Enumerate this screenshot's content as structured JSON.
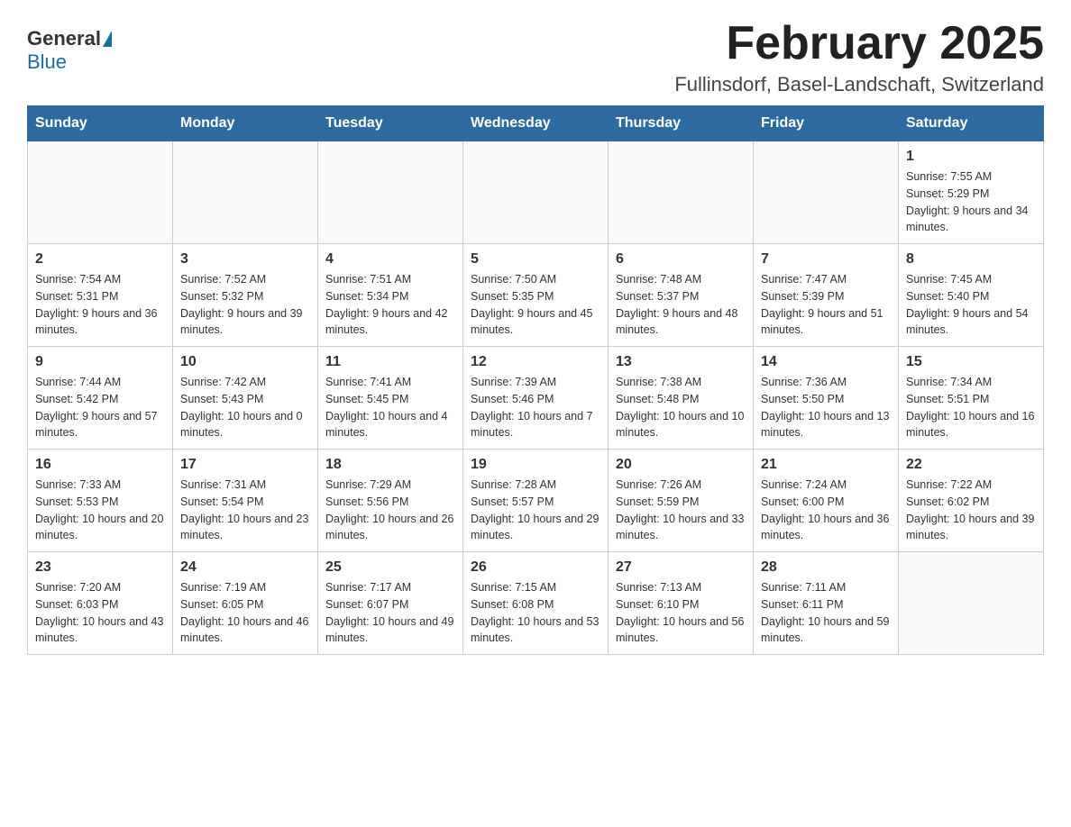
{
  "header": {
    "logo_general": "General",
    "logo_blue": "Blue",
    "month_title": "February 2025",
    "location": "Fullinsdorf, Basel-Landschaft, Switzerland"
  },
  "days_of_week": [
    "Sunday",
    "Monday",
    "Tuesday",
    "Wednesday",
    "Thursday",
    "Friday",
    "Saturday"
  ],
  "weeks": [
    [
      {
        "day": "",
        "info": ""
      },
      {
        "day": "",
        "info": ""
      },
      {
        "day": "",
        "info": ""
      },
      {
        "day": "",
        "info": ""
      },
      {
        "day": "",
        "info": ""
      },
      {
        "day": "",
        "info": ""
      },
      {
        "day": "1",
        "info": "Sunrise: 7:55 AM\nSunset: 5:29 PM\nDaylight: 9 hours and 34 minutes."
      }
    ],
    [
      {
        "day": "2",
        "info": "Sunrise: 7:54 AM\nSunset: 5:31 PM\nDaylight: 9 hours and 36 minutes."
      },
      {
        "day": "3",
        "info": "Sunrise: 7:52 AM\nSunset: 5:32 PM\nDaylight: 9 hours and 39 minutes."
      },
      {
        "day": "4",
        "info": "Sunrise: 7:51 AM\nSunset: 5:34 PM\nDaylight: 9 hours and 42 minutes."
      },
      {
        "day": "5",
        "info": "Sunrise: 7:50 AM\nSunset: 5:35 PM\nDaylight: 9 hours and 45 minutes."
      },
      {
        "day": "6",
        "info": "Sunrise: 7:48 AM\nSunset: 5:37 PM\nDaylight: 9 hours and 48 minutes."
      },
      {
        "day": "7",
        "info": "Sunrise: 7:47 AM\nSunset: 5:39 PM\nDaylight: 9 hours and 51 minutes."
      },
      {
        "day": "8",
        "info": "Sunrise: 7:45 AM\nSunset: 5:40 PM\nDaylight: 9 hours and 54 minutes."
      }
    ],
    [
      {
        "day": "9",
        "info": "Sunrise: 7:44 AM\nSunset: 5:42 PM\nDaylight: 9 hours and 57 minutes."
      },
      {
        "day": "10",
        "info": "Sunrise: 7:42 AM\nSunset: 5:43 PM\nDaylight: 10 hours and 0 minutes."
      },
      {
        "day": "11",
        "info": "Sunrise: 7:41 AM\nSunset: 5:45 PM\nDaylight: 10 hours and 4 minutes."
      },
      {
        "day": "12",
        "info": "Sunrise: 7:39 AM\nSunset: 5:46 PM\nDaylight: 10 hours and 7 minutes."
      },
      {
        "day": "13",
        "info": "Sunrise: 7:38 AM\nSunset: 5:48 PM\nDaylight: 10 hours and 10 minutes."
      },
      {
        "day": "14",
        "info": "Sunrise: 7:36 AM\nSunset: 5:50 PM\nDaylight: 10 hours and 13 minutes."
      },
      {
        "day": "15",
        "info": "Sunrise: 7:34 AM\nSunset: 5:51 PM\nDaylight: 10 hours and 16 minutes."
      }
    ],
    [
      {
        "day": "16",
        "info": "Sunrise: 7:33 AM\nSunset: 5:53 PM\nDaylight: 10 hours and 20 minutes."
      },
      {
        "day": "17",
        "info": "Sunrise: 7:31 AM\nSunset: 5:54 PM\nDaylight: 10 hours and 23 minutes."
      },
      {
        "day": "18",
        "info": "Sunrise: 7:29 AM\nSunset: 5:56 PM\nDaylight: 10 hours and 26 minutes."
      },
      {
        "day": "19",
        "info": "Sunrise: 7:28 AM\nSunset: 5:57 PM\nDaylight: 10 hours and 29 minutes."
      },
      {
        "day": "20",
        "info": "Sunrise: 7:26 AM\nSunset: 5:59 PM\nDaylight: 10 hours and 33 minutes."
      },
      {
        "day": "21",
        "info": "Sunrise: 7:24 AM\nSunset: 6:00 PM\nDaylight: 10 hours and 36 minutes."
      },
      {
        "day": "22",
        "info": "Sunrise: 7:22 AM\nSunset: 6:02 PM\nDaylight: 10 hours and 39 minutes."
      }
    ],
    [
      {
        "day": "23",
        "info": "Sunrise: 7:20 AM\nSunset: 6:03 PM\nDaylight: 10 hours and 43 minutes."
      },
      {
        "day": "24",
        "info": "Sunrise: 7:19 AM\nSunset: 6:05 PM\nDaylight: 10 hours and 46 minutes."
      },
      {
        "day": "25",
        "info": "Sunrise: 7:17 AM\nSunset: 6:07 PM\nDaylight: 10 hours and 49 minutes."
      },
      {
        "day": "26",
        "info": "Sunrise: 7:15 AM\nSunset: 6:08 PM\nDaylight: 10 hours and 53 minutes."
      },
      {
        "day": "27",
        "info": "Sunrise: 7:13 AM\nSunset: 6:10 PM\nDaylight: 10 hours and 56 minutes."
      },
      {
        "day": "28",
        "info": "Sunrise: 7:11 AM\nSunset: 6:11 PM\nDaylight: 10 hours and 59 minutes."
      },
      {
        "day": "",
        "info": ""
      }
    ]
  ]
}
